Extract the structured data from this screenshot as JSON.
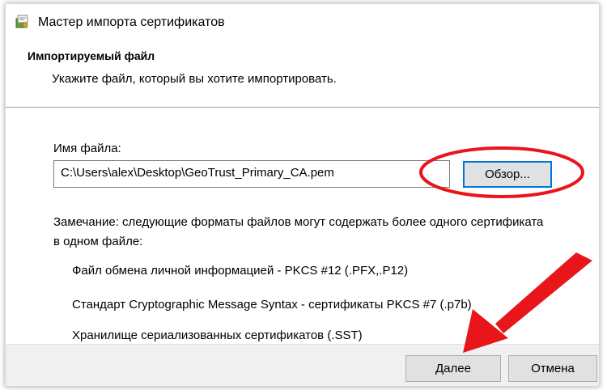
{
  "window": {
    "title": "Мастер импорта сертификатов",
    "icon": "certificate-wizard-icon"
  },
  "header": {
    "title": "Импортируемый файл",
    "subtitle": "Укажите файл, который вы хотите импортировать."
  },
  "file": {
    "label": "Имя файла:",
    "value": "C:\\Users\\alex\\Desktop\\GeoTrust_Primary_CA.pem",
    "browse_label": "Обзор..."
  },
  "note": {
    "line1": "Замечание: следующие форматы файлов могут содержать более одного сертификата",
    "line2": "в одном файле:"
  },
  "formats": [
    "Файл обмена личной информацией - PKCS #12 (.PFX,.P12)",
    "Стандарт Cryptographic Message Syntax - сертификаты PKCS #7 (.p7b)",
    "Хранилище сериализованных сертификатов (.SST)"
  ],
  "footer": {
    "next_label": "Далее",
    "cancel_label": "Отмена"
  },
  "colors": {
    "highlight_red": "#e8151b",
    "focus_blue": "#0078d7"
  }
}
